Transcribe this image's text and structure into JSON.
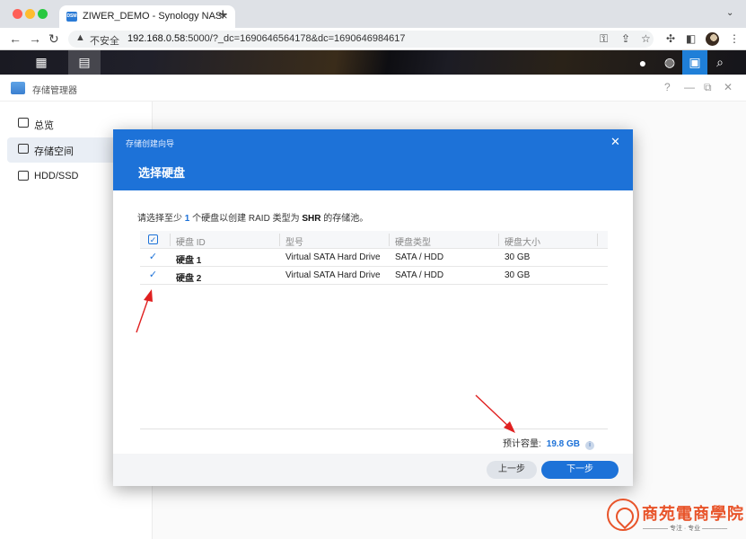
{
  "browser": {
    "tab_title": "ZIWER_DEMO - Synology NAS",
    "tab_favicon": "DSM",
    "not_secure": "不安全",
    "url_host": "192.168.0.58",
    "url_rest": ":5000/?_dc=1690646564178&dc=1690646984617"
  },
  "window": {
    "app_title": "存储管理器",
    "help": "?",
    "minimize": "—",
    "restore": "⧉",
    "close": "✕"
  },
  "sidebar": {
    "items": [
      {
        "label": "总览",
        "icon": "overview-icon",
        "active": false
      },
      {
        "label": "存储空间",
        "icon": "storage-icon",
        "active": true
      },
      {
        "label": "HDD/SSD",
        "icon": "disk-icon",
        "active": false
      }
    ]
  },
  "dialog": {
    "wizard_title": "存储创建向导",
    "step_title": "选择硬盘",
    "instruction": {
      "prefix": "请选择至少",
      "count": "1",
      "middle": "个硬盘以创建 RAID 类型为",
      "raid": "SHR",
      "suffix": "的存储池。"
    },
    "table": {
      "headers": [
        "硬盘 ID",
        "型号",
        "硬盘类型",
        "硬盘大小"
      ],
      "rows": [
        {
          "id": "硬盘 1",
          "model": "Virtual SATA Hard Drive",
          "type": "SATA / HDD",
          "size": "30 GB",
          "checked": true
        },
        {
          "id": "硬盘 2",
          "model": "Virtual SATA Hard Drive",
          "type": "SATA / HDD",
          "size": "30 GB",
          "checked": true
        }
      ]
    },
    "capacity_label": "预计容量:",
    "capacity_value": "19.8 GB",
    "prev_label": "上一步",
    "next_label": "下一步"
  },
  "watermark": {
    "brand": "商苑電商學院",
    "tagline": "———— 专注 · 专业 ————"
  },
  "colors": {
    "accent": "#1d72d8",
    "annotation_arrow": "#e02020",
    "watermark": "#e8542a"
  }
}
